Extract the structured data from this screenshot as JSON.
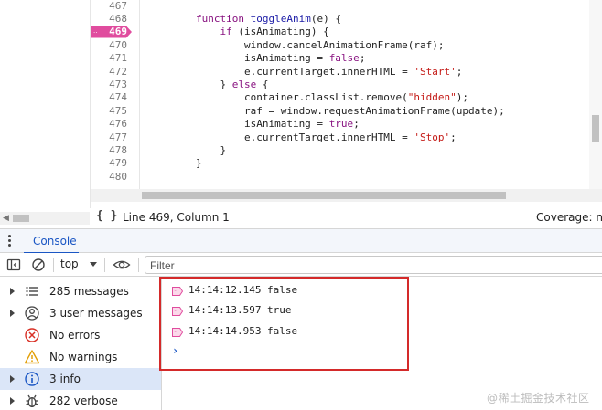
{
  "editor": {
    "lines": [
      {
        "num": "467",
        "tokens": []
      },
      {
        "num": "468",
        "tokens": [
          {
            "c": "kw",
            "t": "        function "
          },
          {
            "c": "fn",
            "t": "toggleAnim"
          },
          {
            "c": "plain",
            "t": "(e) {"
          }
        ]
      },
      {
        "num": "469",
        "breakpoint": true,
        "tokens": [
          {
            "c": "plain",
            "t": "            "
          },
          {
            "c": "kw",
            "t": "if"
          },
          {
            "c": "plain",
            "t": " (isAnimating) {"
          }
        ]
      },
      {
        "num": "470",
        "tokens": [
          {
            "c": "plain",
            "t": "                window.cancelAnimationFrame(raf);"
          }
        ]
      },
      {
        "num": "471",
        "tokens": [
          {
            "c": "plain",
            "t": "                isAnimating = "
          },
          {
            "c": "kw",
            "t": "false"
          },
          {
            "c": "plain",
            "t": ";"
          }
        ]
      },
      {
        "num": "472",
        "tokens": [
          {
            "c": "plain",
            "t": "                e.currentTarget.innerHTML = "
          },
          {
            "c": "str",
            "t": "'Start'"
          },
          {
            "c": "plain",
            "t": ";"
          }
        ]
      },
      {
        "num": "473",
        "tokens": [
          {
            "c": "plain",
            "t": "            } "
          },
          {
            "c": "kw",
            "t": "else"
          },
          {
            "c": "plain",
            "t": " {"
          }
        ]
      },
      {
        "num": "474",
        "tokens": [
          {
            "c": "plain",
            "t": "                container.classList.remove("
          },
          {
            "c": "str",
            "t": "\"hidden\""
          },
          {
            "c": "plain",
            "t": ");"
          }
        ]
      },
      {
        "num": "475",
        "tokens": [
          {
            "c": "plain",
            "t": "                raf = window.requestAnimationFrame(update);"
          }
        ]
      },
      {
        "num": "476",
        "tokens": [
          {
            "c": "plain",
            "t": "                isAnimating = "
          },
          {
            "c": "kw",
            "t": "true"
          },
          {
            "c": "plain",
            "t": ";"
          }
        ]
      },
      {
        "num": "477",
        "tokens": [
          {
            "c": "plain",
            "t": "                e.currentTarget.innerHTML = "
          },
          {
            "c": "str",
            "t": "'Stop'"
          },
          {
            "c": "plain",
            "t": ";"
          }
        ]
      },
      {
        "num": "478",
        "tokens": [
          {
            "c": "plain",
            "t": "            }"
          }
        ]
      },
      {
        "num": "479",
        "tokens": [
          {
            "c": "plain",
            "t": "        }"
          }
        ]
      },
      {
        "num": "480",
        "tokens": []
      }
    ]
  },
  "statusbar": {
    "braces": "{ }",
    "position": "Line 469, Column 1",
    "coverage": "Coverage: n/a"
  },
  "drawer": {
    "tab_label": "Console"
  },
  "toolbar": {
    "context": "top",
    "filter_placeholder": "Filter"
  },
  "sidebar": {
    "items": [
      {
        "label": "285 messages",
        "icon": "list-icon",
        "expandable": true,
        "selected": false
      },
      {
        "label": "3 user messages",
        "icon": "user-circle-icon",
        "expandable": true,
        "selected": false
      },
      {
        "label": "No errors",
        "icon": "error-circle-icon",
        "expandable": false,
        "selected": false
      },
      {
        "label": "No warnings",
        "icon": "warning-triangle-icon",
        "expandable": false,
        "selected": false
      },
      {
        "label": "3 info",
        "icon": "info-circle-icon",
        "expandable": true,
        "selected": true
      },
      {
        "label": "282 verbose",
        "icon": "bug-icon",
        "expandable": true,
        "selected": false
      }
    ]
  },
  "console": {
    "messages": [
      {
        "time": "14:14:12.145",
        "value": "false"
      },
      {
        "time": "14:14:13.597",
        "value": "true"
      },
      {
        "time": "14:14:14.953",
        "value": "false"
      }
    ],
    "prompt": "›"
  },
  "watermark": "@稀土掘金技术社区",
  "colors": {
    "accent": "#1a56c4",
    "breakpoint": "#e04c9e",
    "highlight_box": "#d42a2a",
    "selected_bg": "#dbe6f8"
  }
}
